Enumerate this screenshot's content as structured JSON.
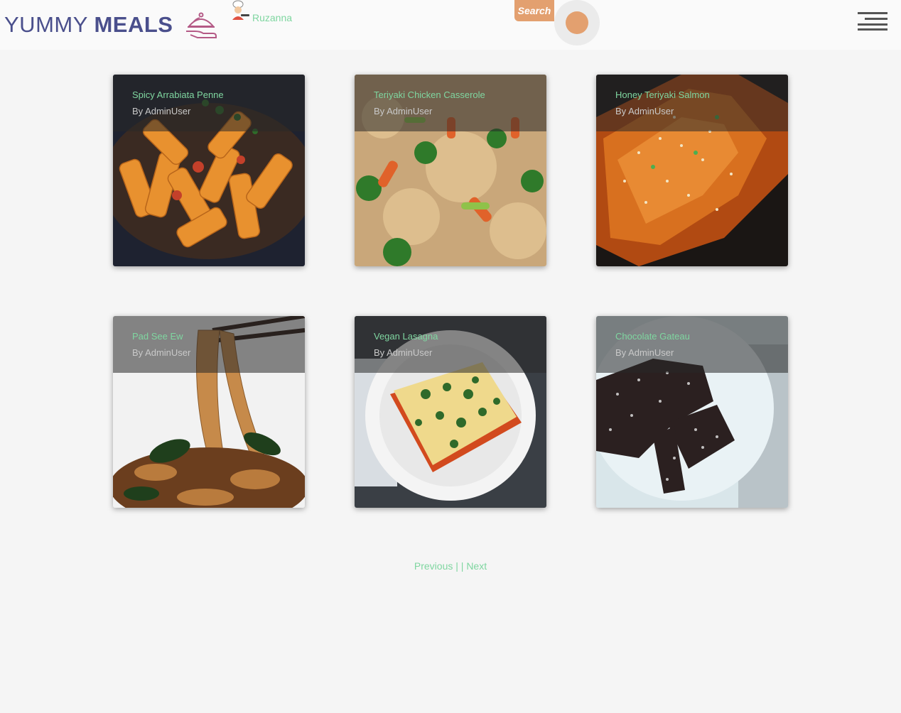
{
  "header": {
    "logo_word1": "YUMMY",
    "logo_word2": "MEALS",
    "user_name": "Ruzanna",
    "search_label": "Search"
  },
  "recipes": [
    {
      "title": "Spicy Arrabiata Penne",
      "author": "By AdminUser"
    },
    {
      "title": "Teriyaki Chicken Casserole",
      "author": "By AdminUser"
    },
    {
      "title": "Honey Teriyaki Salmon",
      "author": "By AdminUser"
    },
    {
      "title": "Pad See Ew",
      "author": "By AdminUser"
    },
    {
      "title": "Vegan Lasagna",
      "author": "By AdminUser"
    },
    {
      "title": "Chocolate Gateau",
      "author": "By AdminUser"
    }
  ],
  "pagination": {
    "previous": "Previous",
    "separator": "| |",
    "next": "Next"
  },
  "colors": {
    "accent_green": "#7fd6a0",
    "accent_orange": "#e3a06f",
    "logo_blue": "#4a4f8c"
  }
}
